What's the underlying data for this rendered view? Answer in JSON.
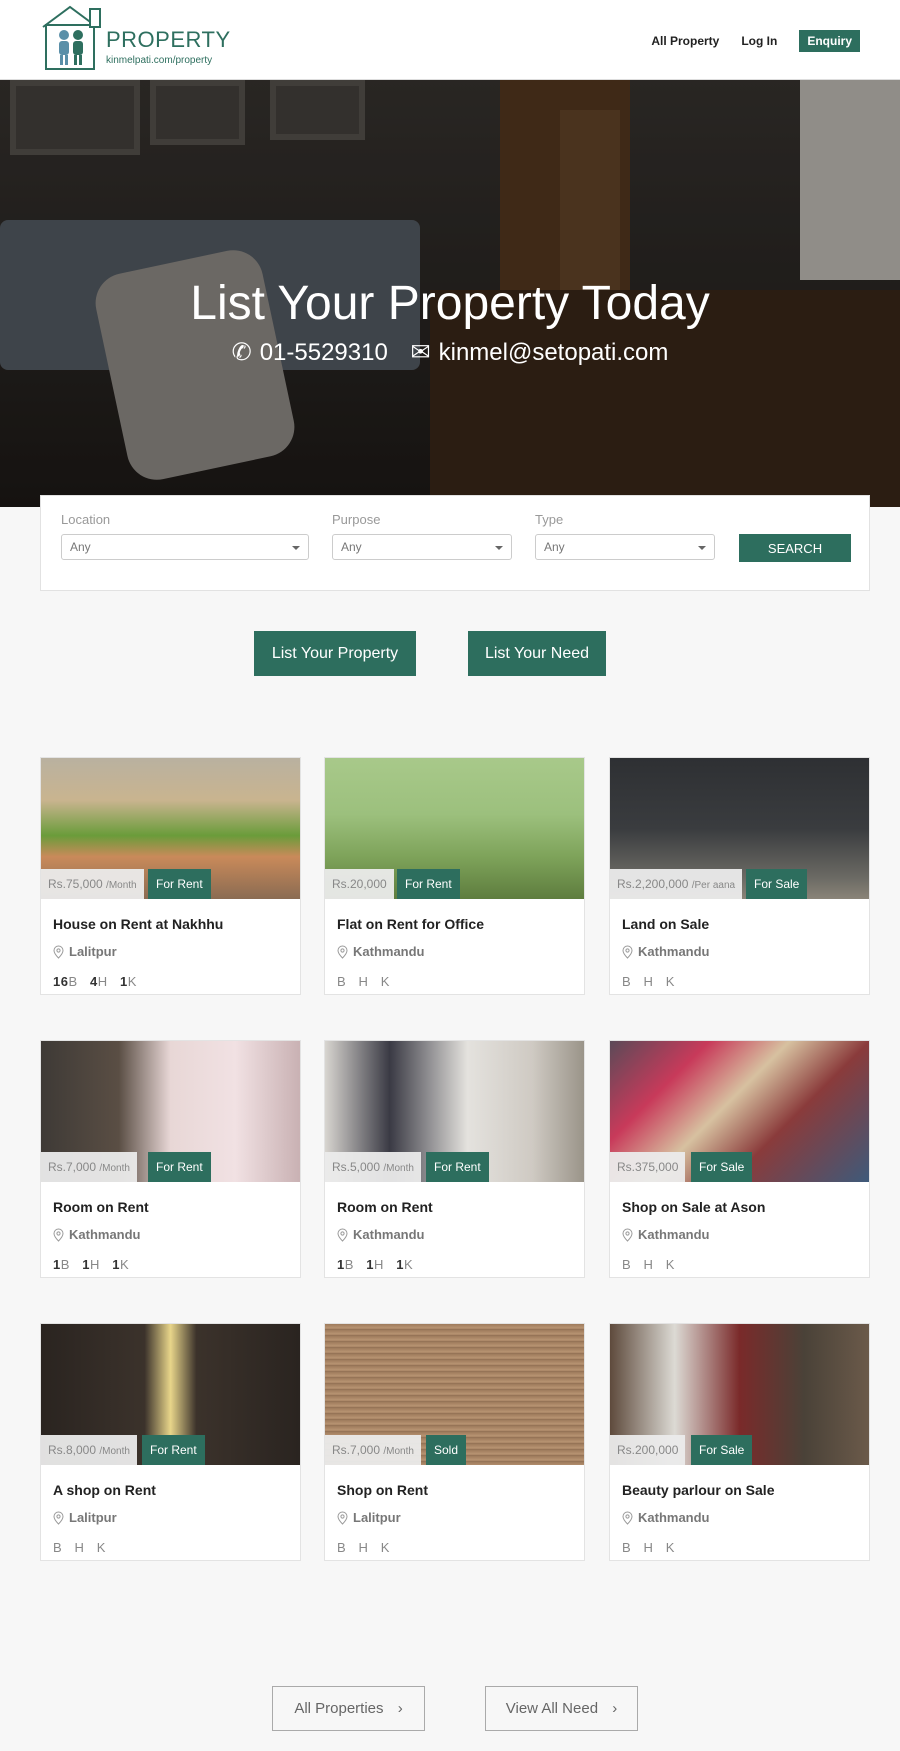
{
  "header": {
    "logo_title": "PROPERTY",
    "logo_subtitle": "kinmelpati.com/property",
    "nav": {
      "all_property": "All Property",
      "login": "Log In",
      "enquiry": "Enquiry"
    }
  },
  "hero": {
    "title": "List Your Property Today",
    "phone": "01-5529310",
    "email": "kinmel@setopati.com"
  },
  "search": {
    "location_label": "Location",
    "location_value": "Any",
    "purpose_label": "Purpose",
    "purpose_value": "Any",
    "type_label": "Type",
    "type_value": "Any",
    "button": "SEARCH"
  },
  "cta": {
    "list_property": "List Your Property",
    "list_need": "List Your Need"
  },
  "listings": [
    {
      "price": "Rs.75,000",
      "period": "/Month",
      "tag": "For Rent",
      "title": "House on Rent at Nakhhu",
      "location": "Lalitpur",
      "b": "16",
      "h": "4",
      "k": "1"
    },
    {
      "price": "Rs.20,000",
      "period": "",
      "tag": "For Rent",
      "title": "Flat on Rent for Office",
      "location": "Kathmandu",
      "b": "",
      "h": "",
      "k": ""
    },
    {
      "price": "Rs.2,200,000",
      "period": "/Per aana",
      "tag": "For Sale",
      "title": "Land on Sale",
      "location": "Kathmandu",
      "b": "",
      "h": "",
      "k": ""
    },
    {
      "price": "Rs.7,000",
      "period": "/Month",
      "tag": "For Rent",
      "title": "Room on Rent",
      "location": "Kathmandu",
      "b": "1",
      "h": "1",
      "k": "1"
    },
    {
      "price": "Rs.5,000",
      "period": "/Month",
      "tag": "For Rent",
      "title": "Room on Rent",
      "location": "Kathmandu",
      "b": "1",
      "h": "1",
      "k": "1"
    },
    {
      "price": "Rs.375,000",
      "period": "",
      "tag": "For Sale",
      "title": "Shop on Sale at Ason",
      "location": "Kathmandu",
      "b": "",
      "h": "",
      "k": ""
    },
    {
      "price": "Rs.8,000",
      "period": "/Month",
      "tag": "For Rent",
      "title": "A shop on Rent",
      "location": "Lalitpur",
      "b": "",
      "h": "",
      "k": ""
    },
    {
      "price": "Rs.7,000",
      "period": "/Month",
      "tag": "Sold",
      "title": "Shop on Rent",
      "location": "Lalitpur",
      "b": "",
      "h": "",
      "k": ""
    },
    {
      "price": "Rs.200,000",
      "period": "",
      "tag": "For Sale",
      "title": "Beauty parlour on Sale",
      "location": "Kathmandu",
      "b": "",
      "h": "",
      "k": ""
    }
  ],
  "bhk_letters": {
    "b": "B",
    "h": "H",
    "k": "K"
  },
  "footer_buttons": {
    "all_properties": "All Properties",
    "view_all_need": "View All Need"
  },
  "colors": {
    "brand": "#2d6e5e",
    "background": "#f7f7f7"
  }
}
